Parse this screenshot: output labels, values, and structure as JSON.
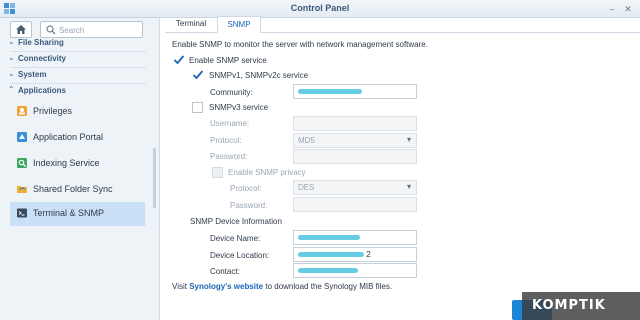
{
  "window": {
    "title": "Control Panel"
  },
  "sidebar": {
    "search_placeholder": "Search",
    "sections": [
      {
        "label": "File Sharing"
      },
      {
        "label": "Connectivity"
      },
      {
        "label": "System"
      },
      {
        "label": "Applications"
      }
    ],
    "items": [
      {
        "label": "Privileges",
        "icon": "privileges-icon"
      },
      {
        "label": "Application Portal",
        "icon": "application-portal-icon"
      },
      {
        "label": "Indexing Service",
        "icon": "indexing-service-icon"
      },
      {
        "label": "Shared Folder Sync",
        "icon": "shared-folder-sync-icon"
      },
      {
        "label": "Terminal & SNMP",
        "icon": "terminal-snmp-icon",
        "active": true
      }
    ]
  },
  "tabs": [
    {
      "label": "Terminal"
    },
    {
      "label": "SNMP",
      "active": true
    }
  ],
  "snmp": {
    "intro": "Enable SNMP to monitor the server with network management software.",
    "enable_label": "Enable SNMP service",
    "v1_label": "SNMPv1, SNMPv2c service",
    "community_label": "Community:",
    "v3_label": "SNMPv3 service",
    "username_label": "Username:",
    "protocol_label": "Protocol:",
    "protocol_value": "MD5",
    "password_label": "Password:",
    "privacy_label": "Enable SNMP privacy",
    "privacy_protocol_label": "Protocol:",
    "privacy_protocol_value": "DES",
    "privacy_password_label": "Password:",
    "device_info_label": "SNMP Device Information",
    "device_name_label": "Device Name:",
    "device_location_label": "Device Location:",
    "device_location_suffix": "2",
    "contact_label": "Contact:",
    "footer_prefix": "Visit ",
    "footer_link": "Synology's website",
    "footer_suffix": " to download the Synology MIB files."
  },
  "watermark": {
    "text": "KOMPTIK"
  },
  "colors": {
    "accent": "#1a66b8",
    "selected": "#c9e0f7",
    "redaction": "#55c7e0",
    "button": "#1b86d8"
  }
}
